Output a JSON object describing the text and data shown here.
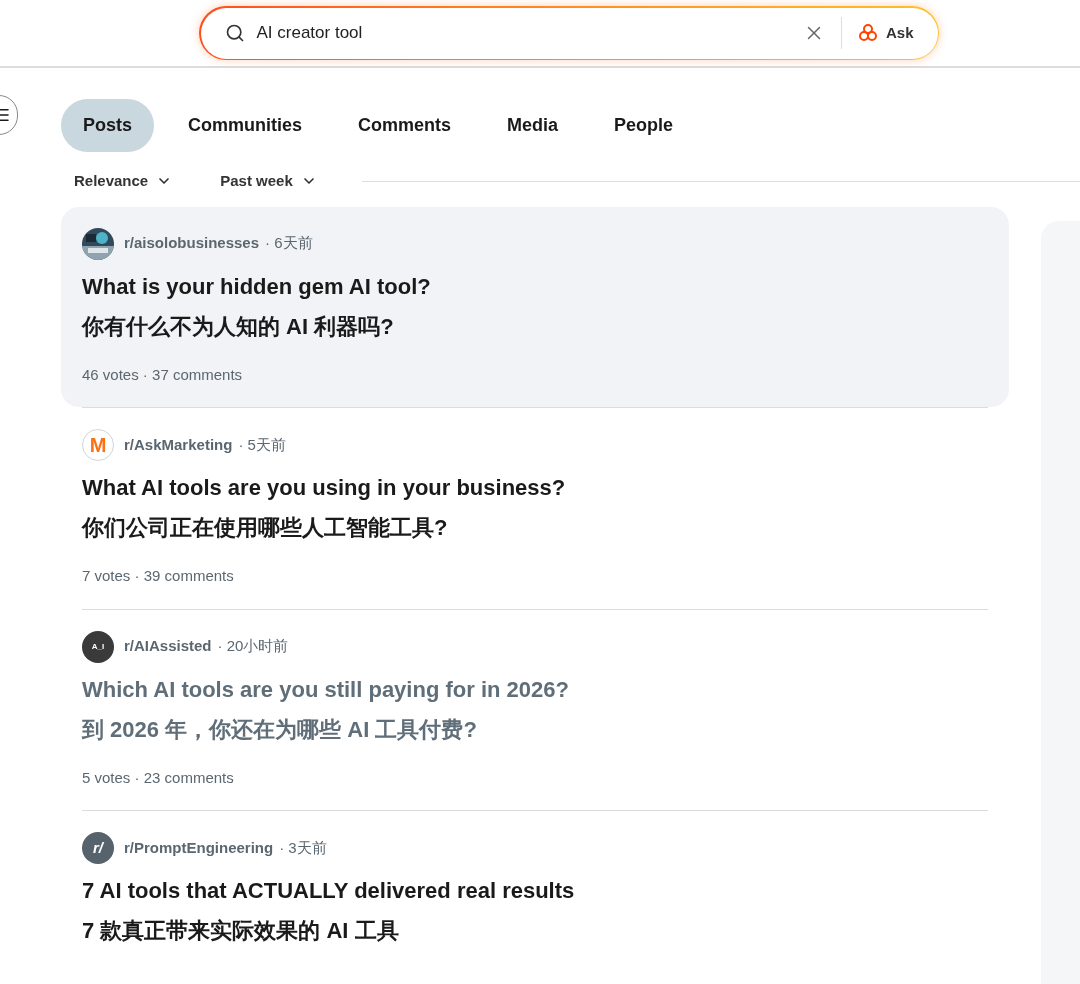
{
  "search": {
    "value": "AI creator tool",
    "ask_label": "Ask"
  },
  "tabs": [
    {
      "label": "Posts",
      "selected": true
    },
    {
      "label": "Communities",
      "selected": false
    },
    {
      "label": "Comments",
      "selected": false
    },
    {
      "label": "Media",
      "selected": false
    },
    {
      "label": "People",
      "selected": false
    }
  ],
  "meta_separator": "·",
  "filters": [
    {
      "label": "Relevance"
    },
    {
      "label": "Past week"
    }
  ],
  "posts": [
    {
      "community": "r/aisolobusinesses",
      "time": "6天前",
      "title": "What is your hidden gem AI tool?",
      "title_zh": "你有什么不为人知的 AI 利器吗?",
      "stats": "46 votes · 37 comments",
      "highlighted": true,
      "visited": false
    },
    {
      "avatar": {
        "kind": "orange",
        "text": "M"
      },
      "community": "r/AskMarketing",
      "time": "5天前",
      "title": "What AI tools are you using in your business?",
      "title_zh": "你们公司正在使用哪些人工智能工具?",
      "stats": "7 votes · 39 comments",
      "highlighted": false,
      "visited": false
    },
    {
      "avatar": {
        "kind": "dark",
        "text": "A_I"
      },
      "community": "r/AIAssisted",
      "time": "20小时前",
      "title": "Which AI tools are you still paying for in 2026?",
      "title_zh": "到 2026 年，你还在为哪些 AI 工具付费?",
      "stats": "5 votes · 23 comments",
      "highlighted": false,
      "visited": true
    },
    {
      "avatar": {
        "kind": "slate",
        "text": "r/"
      },
      "community": "r/PromptEngineering",
      "time": "3天前",
      "title": "7 AI tools that ACTUALLY delivered real results",
      "title_zh": "7 款真正带来实际效果的 AI 工具",
      "highlighted": false,
      "visited": false
    }
  ]
}
